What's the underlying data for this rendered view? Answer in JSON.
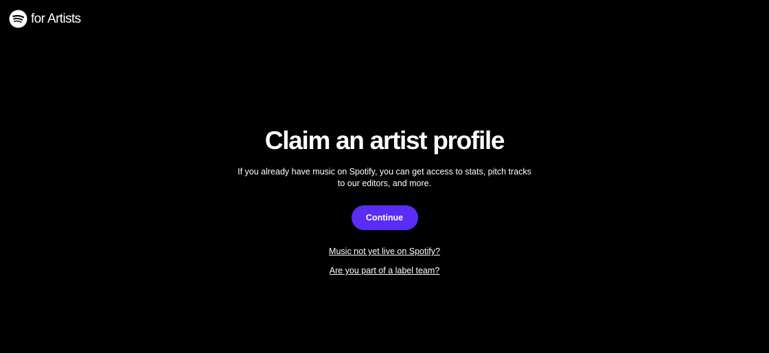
{
  "header": {
    "brand_text": "for Artists",
    "logo_icon": "spotify-logo-icon"
  },
  "main": {
    "title": "Claim an artist profile",
    "subtitle": "If you already have music on Spotify, you can get access to stats, pitch tracks to our editors, and more.",
    "continue_label": "Continue",
    "link_not_live": "Music not yet live on Spotify?",
    "link_label_team": "Are you part of a label team?"
  },
  "colors": {
    "background": "#000000",
    "text": "#ffffff",
    "accent": "#5a2cf6"
  }
}
